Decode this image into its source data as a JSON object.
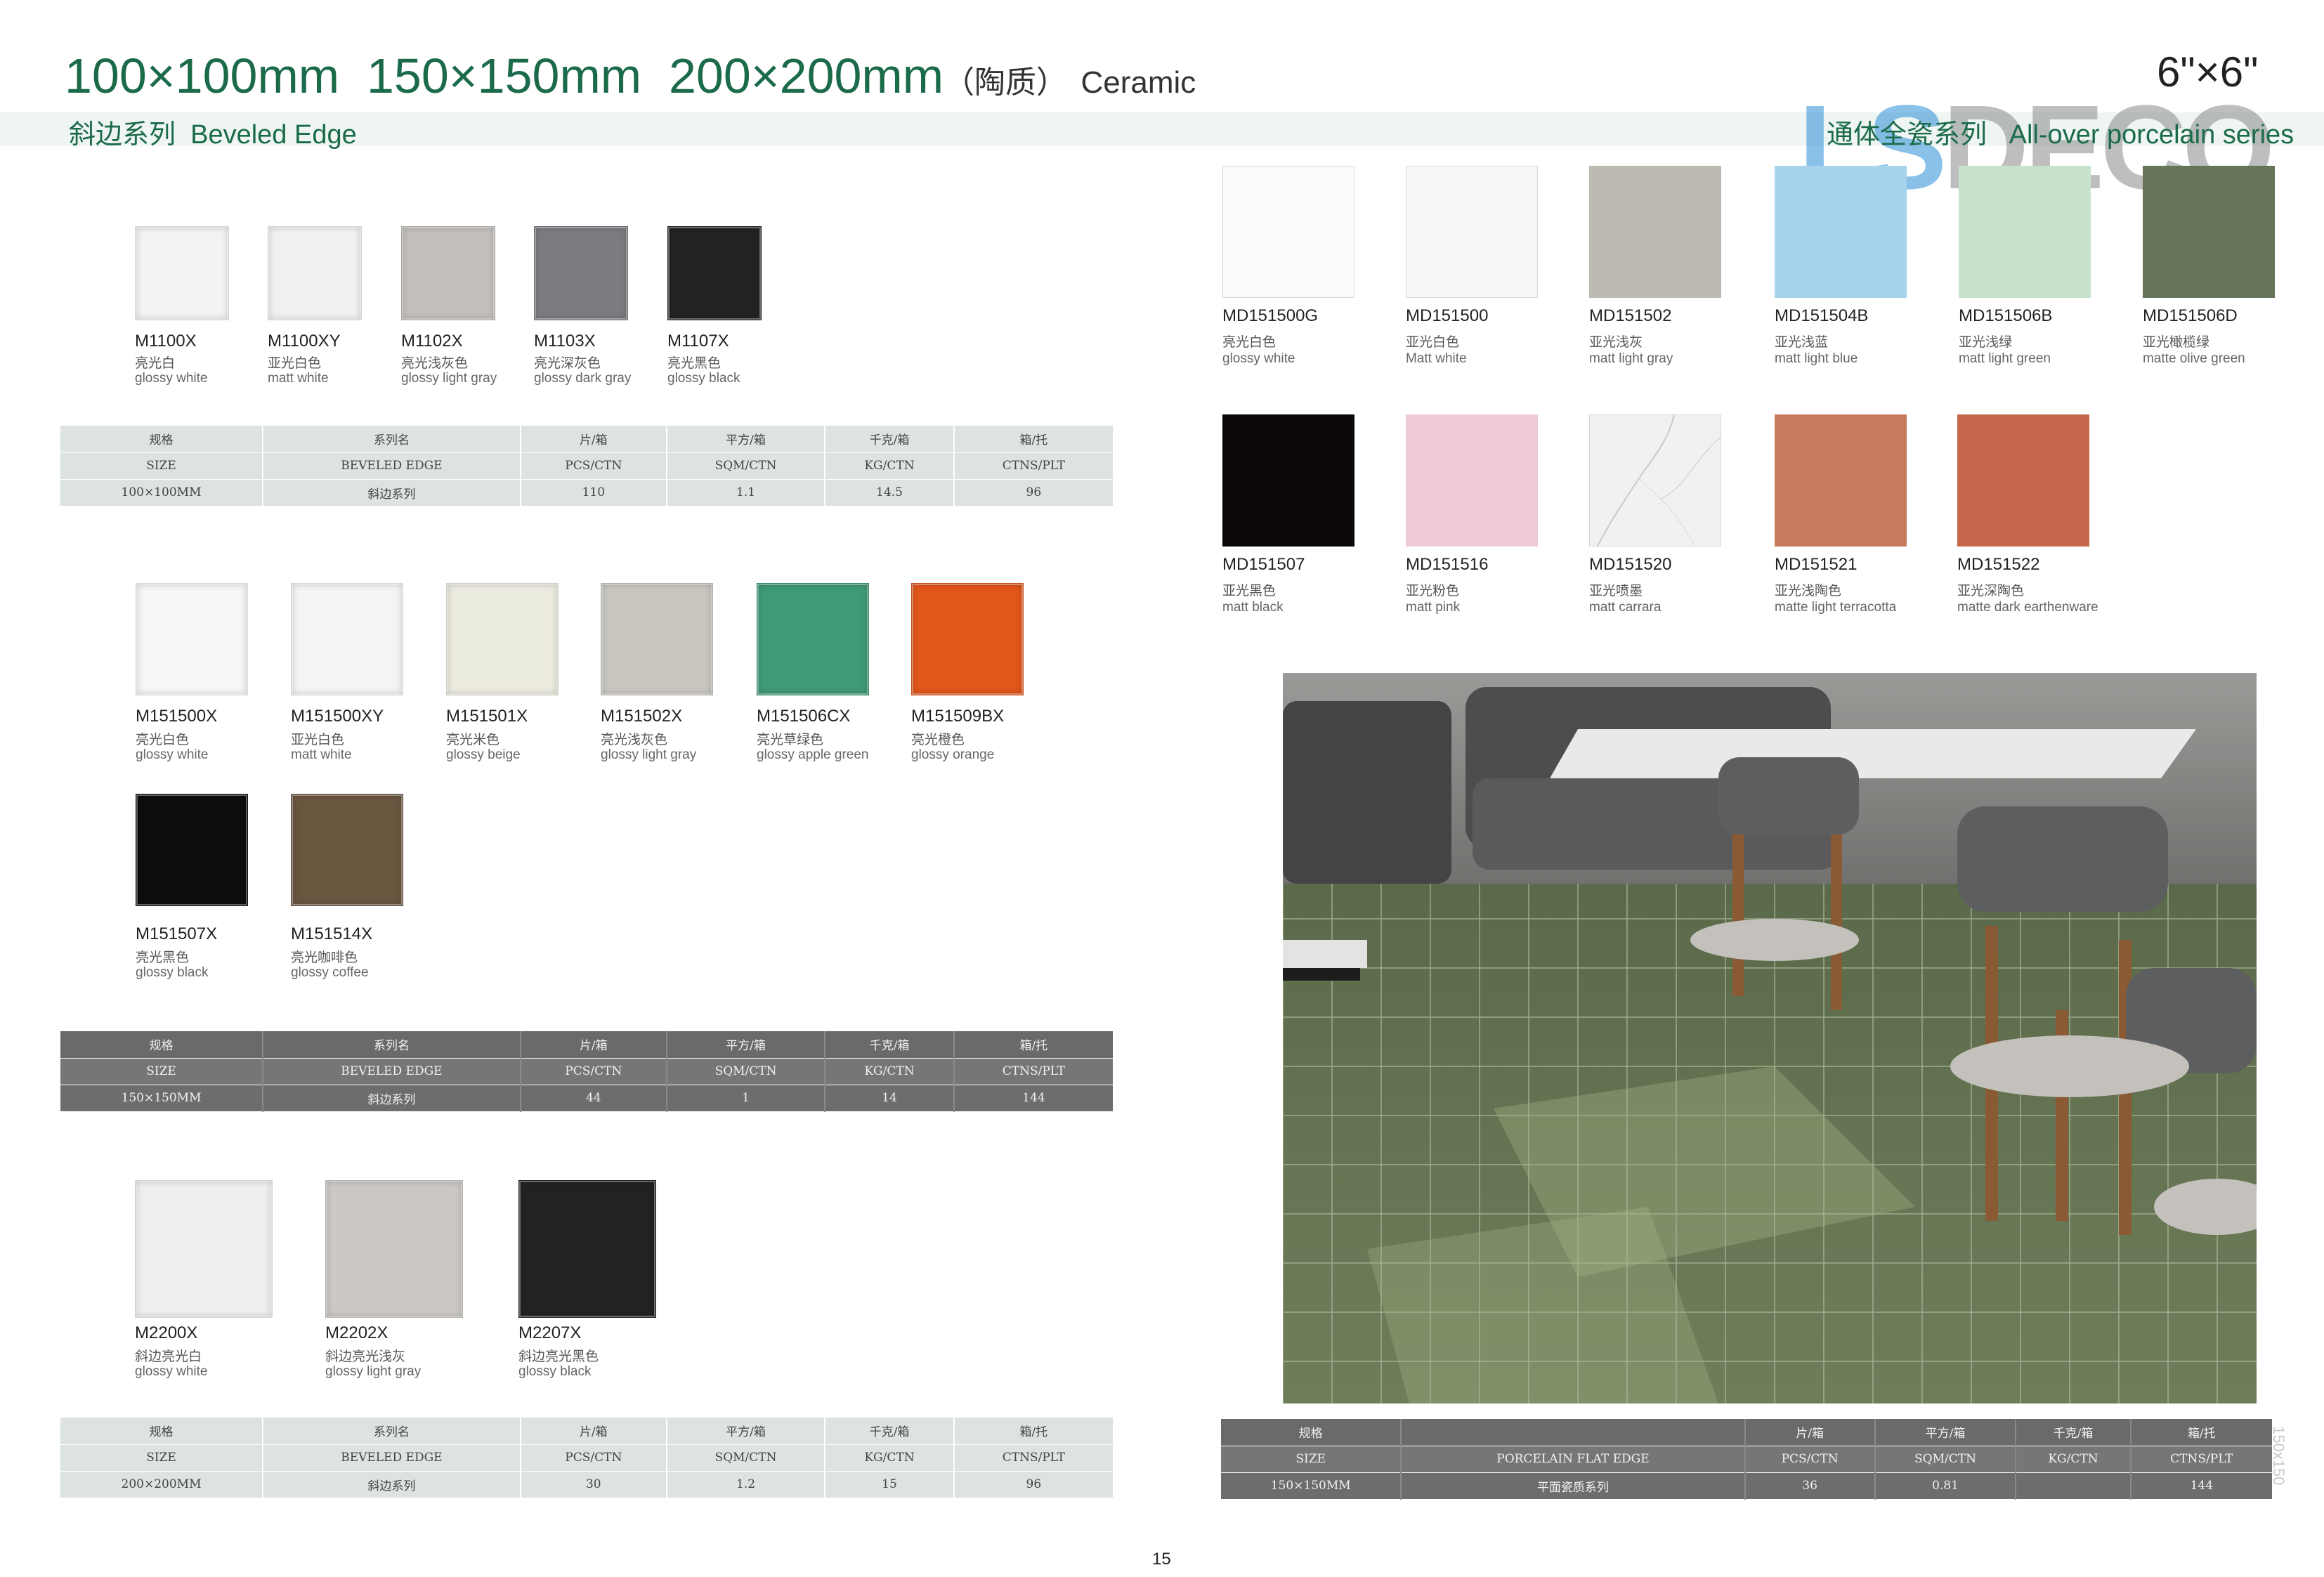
{
  "header": {
    "title": "100×100mm  150×150mm  200×200mm",
    "title_suffix_cn": "（陶质）",
    "title_suffix_en": "Ceramic",
    "subtitle_left": "斜边系列  Beveled Edge",
    "size_right": "6\"×6\"",
    "subtitle_right": "通体全瓷系列   All-over porcelain series",
    "logo_part1": "LS",
    "logo_part2": "DECO"
  },
  "section1_tiles": [
    {
      "code": "M1100X",
      "cn": "亮光白",
      "en": "glossy white",
      "color": "#f2f3f4"
    },
    {
      "code": "M1100XY",
      "cn": "亚光白色",
      "en": "matt white",
      "color": "#f1f1f0"
    },
    {
      "code": "M1102X",
      "cn": "亮光浅灰色",
      "en": "glossy light gray",
      "color": "#c2bfbc"
    },
    {
      "code": "M1103X",
      "cn": "亮光深灰色",
      "en": "glossy dark gray",
      "color": "#7c7c80"
    },
    {
      "code": "M1107X",
      "cn": "亮光黑色",
      "en": "glossy black",
      "color": "#232323"
    }
  ],
  "table1": {
    "headers_cn": [
      "规格",
      "系列名",
      "片/箱",
      "平方/箱",
      "千克/箱",
      "箱/托"
    ],
    "headers_en": [
      "SIZE",
      "BEVELED EDGE",
      "PCS/CTN",
      "SQM/CTN",
      "KG/CTN",
      "CTNS/PLT"
    ],
    "values": [
      "100×100MM",
      "斜边系列",
      "110",
      "1.1",
      "14.5",
      "96"
    ]
  },
  "section2_tiles": [
    {
      "code": "M151500X",
      "cn": "亮光白色",
      "en": "glossy white",
      "color": "#f6f6f6"
    },
    {
      "code": "M151500XY",
      "cn": "亚光白色",
      "en": "matt white",
      "color": "#f4f4f2"
    },
    {
      "code": "M151501X",
      "cn": "亮光米色",
      "en": "glossy beige",
      "color": "#ecebe0"
    },
    {
      "code": "M151502X",
      "cn": "亮光浅灰色",
      "en": "glossy light gray",
      "color": "#c8c6bf"
    },
    {
      "code": "M151506CX",
      "cn": "亮光草绿色",
      "en": "glossy apple green",
      "color": "#3f9a76"
    },
    {
      "code": "M151509BX",
      "cn": "亮光橙色",
      "en": "glossy orange",
      "color": "#e1561a"
    },
    {
      "code": "M151507X",
      "cn": "亮光黑色",
      "en": "glossy black",
      "color": "#0d0d0f"
    },
    {
      "code": "M151514X",
      "cn": "亮光咖啡色",
      "en": "glossy coffee",
      "color": "#6a563f"
    }
  ],
  "table2": {
    "headers_cn": [
      "规格",
      "系列名",
      "片/箱",
      "平方/箱",
      "千克/箱",
      "箱/托"
    ],
    "headers_en": [
      "SIZE",
      "BEVELED EDGE",
      "PCS/CTN",
      "SQM/CTN",
      "KG/CTN",
      "CTNS/PLT"
    ],
    "values": [
      "150×150MM",
      "斜边系列",
      "44",
      "1",
      "14",
      "144"
    ]
  },
  "section3_tiles": [
    {
      "code": "M2200X",
      "cn": "斜边亮光白",
      "en": "glossy white",
      "color": "#eeeff0"
    },
    {
      "code": "M2202X",
      "cn": "斜边亮光浅灰",
      "en": "glossy light gray",
      "color": "#cbc8c5"
    },
    {
      "code": "M2207X",
      "cn": "斜边亮光黑色",
      "en": "glossy black",
      "color": "#222224"
    }
  ],
  "table3": {
    "headers_cn": [
      "规格",
      "系列名",
      "片/箱",
      "平方/箱",
      "千克/箱",
      "箱/托"
    ],
    "headers_en": [
      "SIZE",
      "BEVELED EDGE",
      "PCS/CTN",
      "SQM/CTN",
      "KG/CTN",
      "CTNS/PLT"
    ],
    "values": [
      "200×200MM",
      "斜边系列",
      "30",
      "1.2",
      "15",
      "96"
    ]
  },
  "porcelain_tiles": [
    {
      "code": "MD151500G",
      "cn": "亮光白色",
      "en": "glossy white",
      "color": "#fbfbfb"
    },
    {
      "code": "MD151500",
      "cn": "亚光白色",
      "en": "Matt white",
      "color": "#f7f7f7"
    },
    {
      "code": "MD151502",
      "cn": "亚光浅灰",
      "en": "matt light gray",
      "color": "#bcbab3"
    },
    {
      "code": "MD151504B",
      "cn": "亚光浅蓝",
      "en": "matt light blue",
      "color": "#a7d3ec"
    },
    {
      "code": "MD151506B",
      "cn": "亚光浅绿",
      "en": "matt light green",
      "color": "#c7e3ce"
    },
    {
      "code": "MD151506D",
      "cn": "亚光橄榄绿",
      "en": "matte olive green",
      "color": "#66755a"
    },
    {
      "code": "MD151507",
      "cn": "亚光黑色",
      "en": "matt black",
      "color": "#0c0708"
    },
    {
      "code": "MD151516",
      "cn": "亚光粉色",
      "en": "matt pink",
      "color": "#efcbd6"
    },
    {
      "code": "MD151520",
      "cn": "亚光喷墨",
      "en": "matt carrara",
      "color": "#f1f1f1"
    },
    {
      "code": "MD151521",
      "cn": "亚光浅陶色",
      "en": "matte light terracotta",
      "color": "#c97b5e"
    },
    {
      "code": "MD151522",
      "cn": "亚光深陶色",
      "en": "matte dark earthenware",
      "color": "#c4674a"
    }
  ],
  "table4": {
    "headers_cn": [
      "规格",
      "",
      "片/箱",
      "平方/箱",
      "千克/箱",
      "箱/托"
    ],
    "headers_en": [
      "SIZE",
      "PORCELAIN FLAT EDGE",
      "PCS/CTN",
      "SQM/CTN",
      "KG/CTN",
      "CTNS/PLT"
    ],
    "values": [
      "150×150MM",
      "平面瓷质系列",
      "36",
      "0.81",
      "",
      "144"
    ]
  },
  "vertical_note": "150x150",
  "page_number": "15"
}
